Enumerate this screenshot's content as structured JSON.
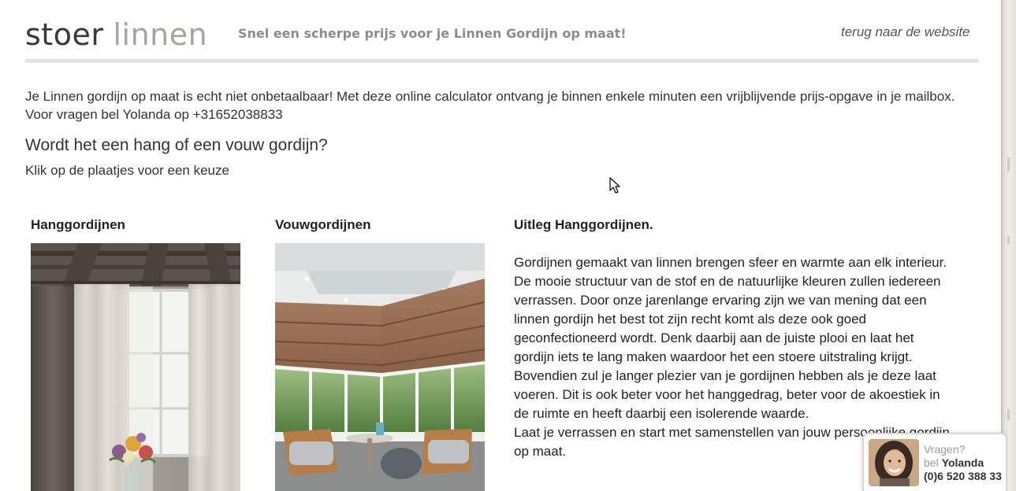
{
  "header": {
    "logo_word1": "stoer",
    "logo_word2": "linnen",
    "tagline": "Snel een scherpe prijs voor je Linnen Gordijn op maat!",
    "back_link": "terug naar de website"
  },
  "intro": {
    "text": "Je Linnen gordijn op maat is echt niet onbetaalbaar! Met deze online calculator ontvang je binnen enkele minuten een vrijblijvende prijs-opgave in je mailbox. Voor vragen bel Yolanda op +31652038833",
    "question": "Wordt het een hang of een vouw gordijn?",
    "hint": "Klik op de plaatjes voor een keuze"
  },
  "options": [
    {
      "title": "Hanggordijnen",
      "image_icon": "hanging-curtains-photo"
    },
    {
      "title": "Vouwgordijnen",
      "image_icon": "roman-blinds-photo"
    }
  ],
  "explanation": {
    "title": "Uitleg Hanggordijnen.",
    "lines": [
      "Gordijnen gemaakt van linnen brengen sfeer en warmte aan elk interieur.",
      "De mooie structuur van de stof en de  natuurlijke kleuren zullen iedereen",
      "verrassen. Door onze jarenlange ervaring zijn we van mening dat een",
      "linnen gordijn het best tot zijn recht komt als deze ook goed",
      "geconfectioneerd wordt. Denk daarbij aan de juiste plooi en laat het",
      "gordijn iets te lang maken waardoor het een stoere uitstraling krijgt.",
      "Bovendien zul je langer plezier van je gordijnen hebben als je deze laat",
      "voeren. Dit is ook beter voor het hanggedrag, beter voor de akoestiek in",
      "de ruimte en heeft daarbij een isolerende waarde.",
      "Laat je verrassen en start met samenstellen van jouw persoonlijke gordijn",
      "op maat."
    ]
  },
  "contact_widget": {
    "line1": "Vragen?",
    "line2_prefix": "bel",
    "line2_name": "Yolanda",
    "phone": "(0)6 520 388 33",
    "avatar_icon": "yolanda-avatar"
  },
  "colors": {
    "logo_dark": "#3b3735",
    "logo_light": "#a7a39f",
    "tagline": "#8c8c8c",
    "rule": "#e4e4e4"
  }
}
